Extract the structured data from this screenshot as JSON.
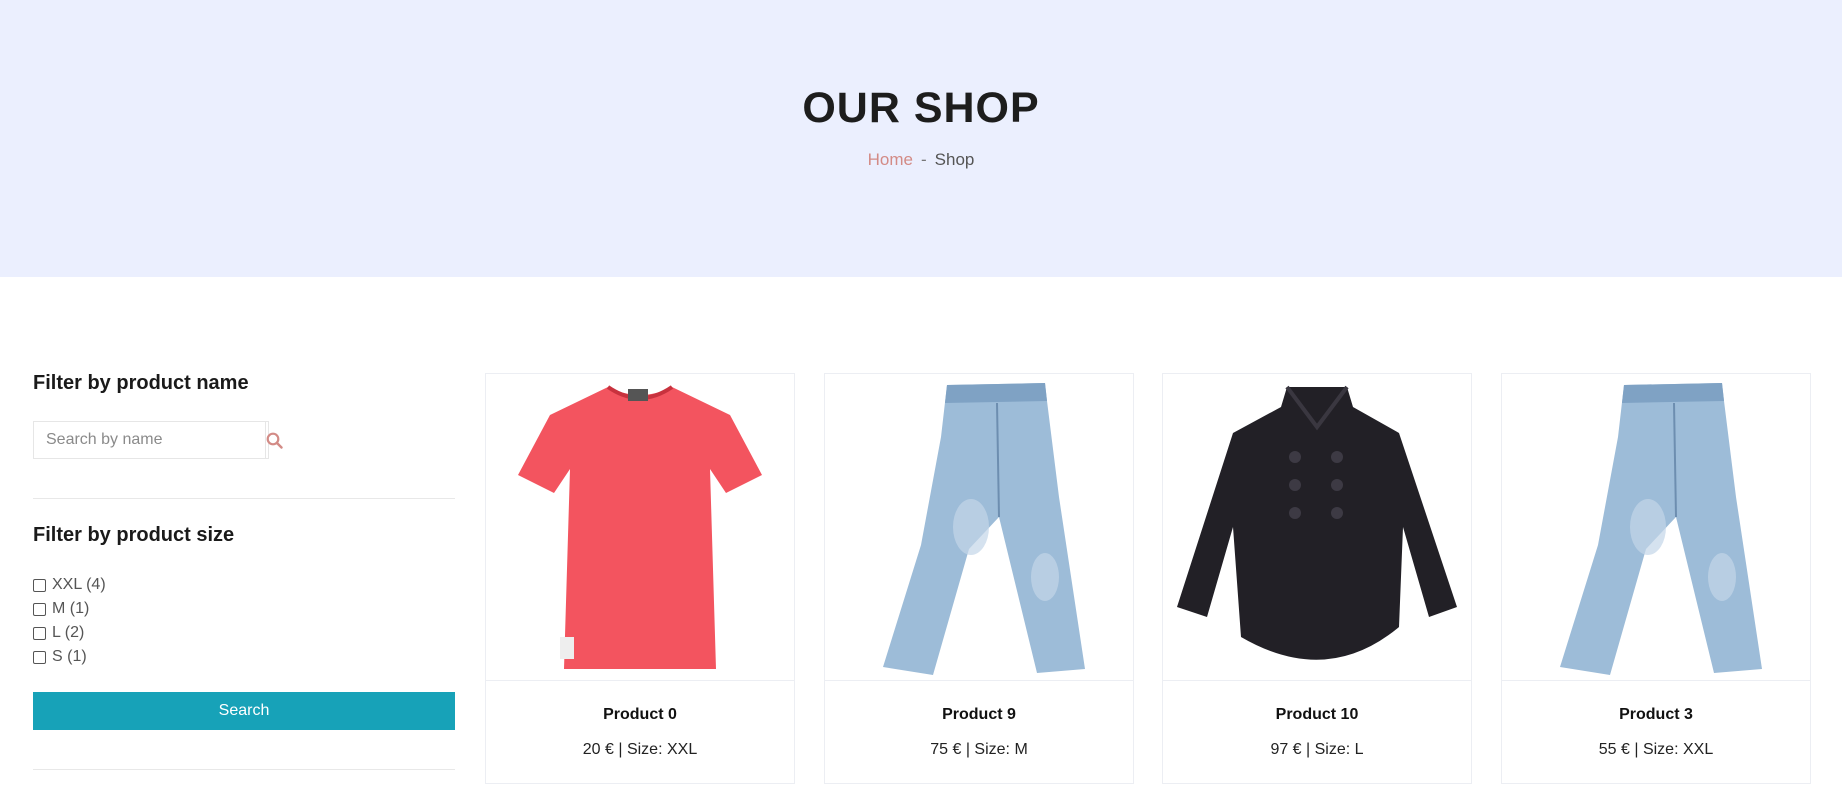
{
  "hero": {
    "title": "OUR SHOP",
    "breadcrumb": {
      "home": "Home",
      "separator": "-",
      "current": "Shop"
    }
  },
  "sidebar": {
    "name_filter": {
      "heading": "Filter by product name",
      "placeholder": "Search by name",
      "value": "",
      "icon": "search-icon"
    },
    "size_filter": {
      "heading": "Filter by product size",
      "options": [
        {
          "label": "XXL (4)",
          "checked": false
        },
        {
          "label": "M (1)",
          "checked": false
        },
        {
          "label": "L (2)",
          "checked": false
        },
        {
          "label": "S (1)",
          "checked": false
        }
      ]
    },
    "search_button": "Search"
  },
  "products": [
    {
      "name": "Product 0",
      "meta": "20 € | Size: XXL",
      "image": "red-tshirt"
    },
    {
      "name": "Product 9",
      "meta": "75 € | Size: M",
      "image": "blue-jeans"
    },
    {
      "name": "Product 10",
      "meta": "97 € | Size: L",
      "image": "black-coat"
    },
    {
      "name": "Product 3",
      "meta": "55 € | Size: XXL",
      "image": "blue-jeans"
    }
  ],
  "colors": {
    "hero_bg": "#ebeffe",
    "accent": "#17a2b8",
    "link": "#d38b86"
  }
}
